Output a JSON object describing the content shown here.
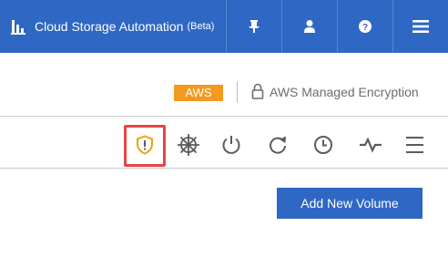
{
  "header": {
    "app_title": "Cloud Storage Automation",
    "beta_label": "(Beta)",
    "icons": [
      "bar-chart-icon",
      "pin-icon",
      "user-icon",
      "help-icon",
      "menu-icon"
    ]
  },
  "subheader": {
    "provider_badge": "AWS",
    "encryption_label": "AWS Managed Encryption"
  },
  "toolbar": {
    "icons": [
      "shield-alert-icon",
      "helm-icon",
      "power-icon",
      "refresh-icon",
      "clock-icon",
      "activity-icon",
      "menu-icon"
    ]
  },
  "actions": {
    "add_volume_label": "Add New Volume"
  },
  "colors": {
    "primary": "#2f67c4",
    "badge": "#f29a1f",
    "highlight": "#e64545",
    "shield": "#e8a317",
    "icon_gray": "#5b5b5b"
  }
}
